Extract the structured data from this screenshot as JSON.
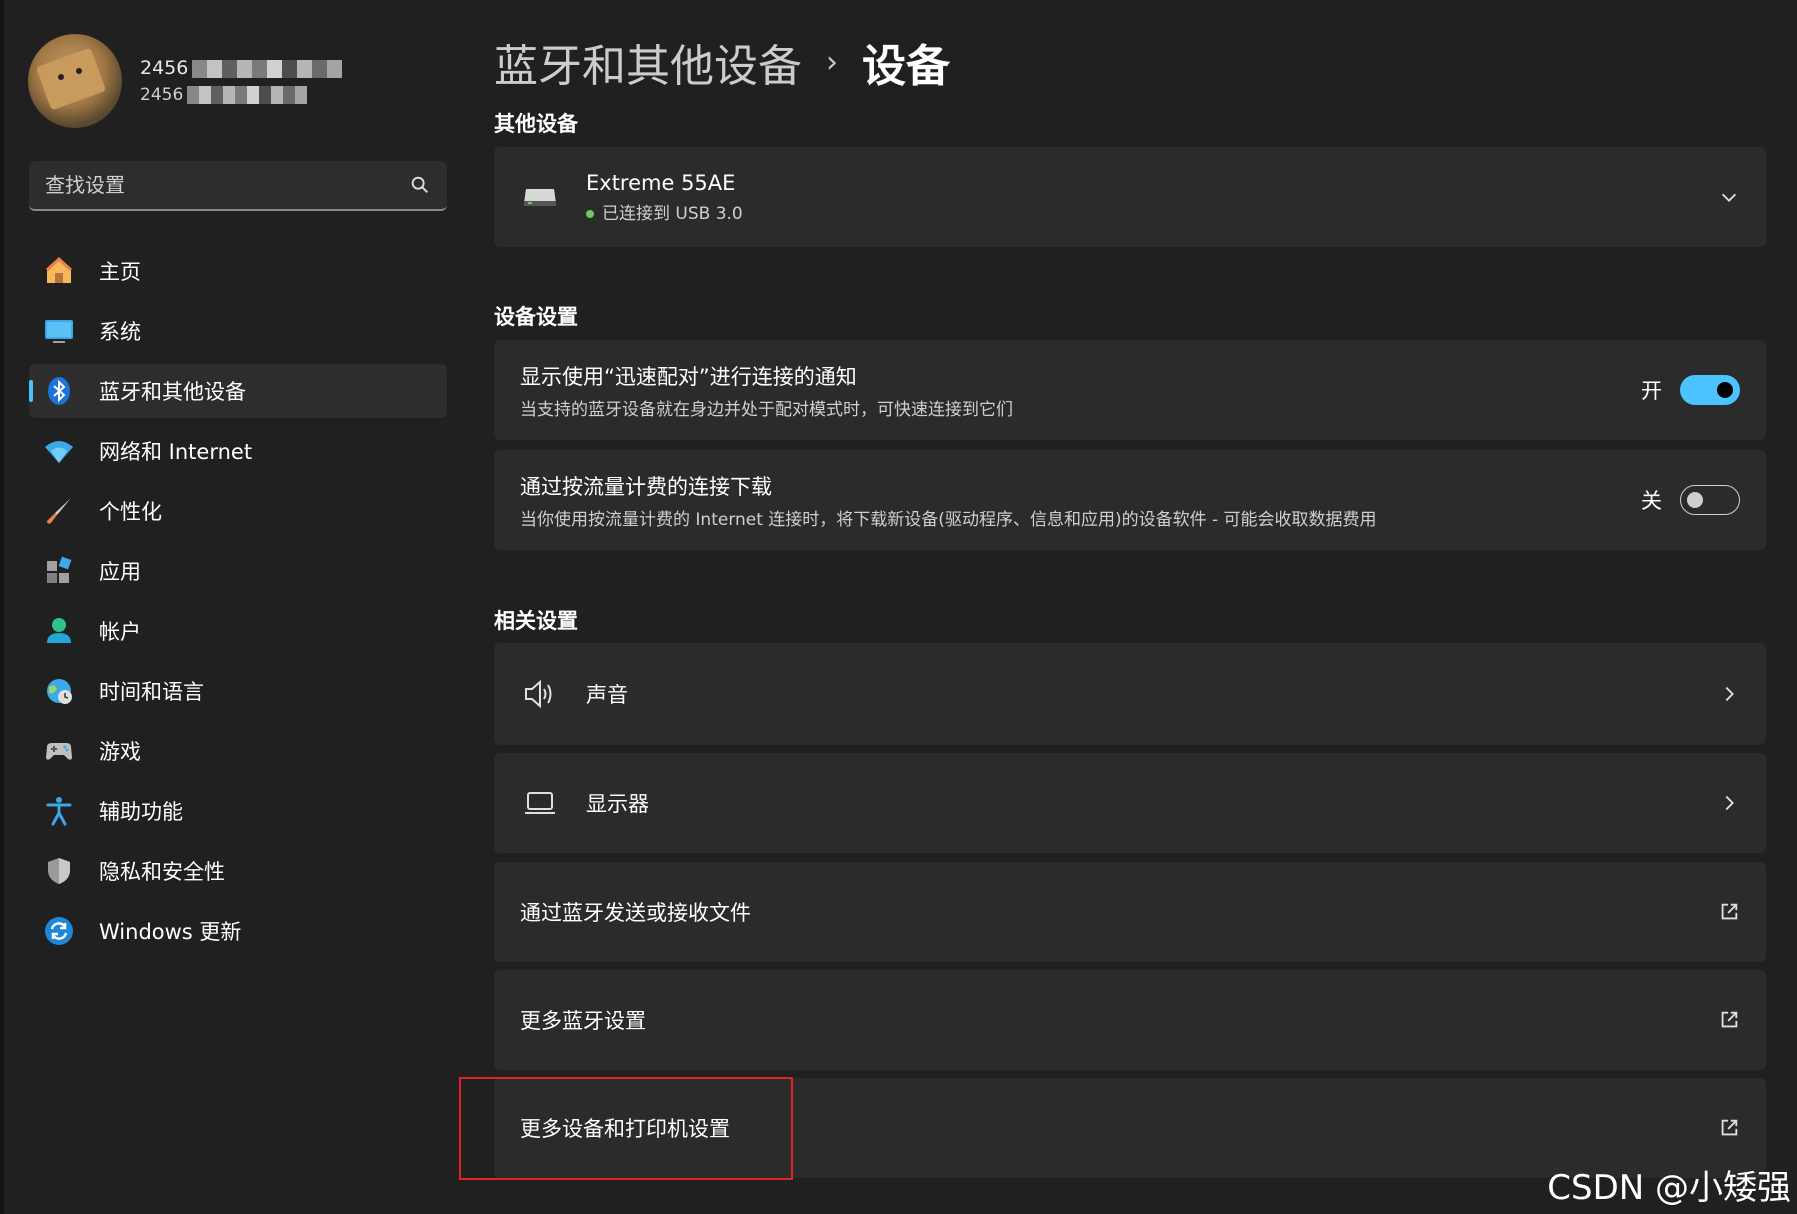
{
  "profile": {
    "name": "2456",
    "email": "2456"
  },
  "search": {
    "placeholder": "查找设置"
  },
  "nav": {
    "items": [
      {
        "label": "主页",
        "icon": "home-icon"
      },
      {
        "label": "系统",
        "icon": "system-icon"
      },
      {
        "label": "蓝牙和其他设备",
        "icon": "bluetooth-icon",
        "active": true
      },
      {
        "label": "网络和 Internet",
        "icon": "wifi-icon"
      },
      {
        "label": "个性化",
        "icon": "brush-icon"
      },
      {
        "label": "应用",
        "icon": "apps-icon"
      },
      {
        "label": "帐户",
        "icon": "account-icon"
      },
      {
        "label": "时间和语言",
        "icon": "globe-clock-icon"
      },
      {
        "label": "游戏",
        "icon": "gamepad-icon"
      },
      {
        "label": "辅助功能",
        "icon": "accessibility-icon"
      },
      {
        "label": "隐私和安全性",
        "icon": "shield-icon"
      },
      {
        "label": "Windows 更新",
        "icon": "update-icon"
      }
    ]
  },
  "breadcrumb": {
    "parent": "蓝牙和其他设备",
    "separator": "›",
    "current": "设备"
  },
  "sections": {
    "other_devices": "其他设备",
    "device_settings": "设备设置",
    "related_settings": "相关设置"
  },
  "device": {
    "name": "Extreme 55AE",
    "status": "已连接到 USB 3.0"
  },
  "swift_pair": {
    "title": "显示使用“迅速配对”进行连接的通知",
    "desc": "当支持的蓝牙设备就在身边并处于配对模式时，可快速连接到它们",
    "state_label": "开"
  },
  "metered": {
    "title": "通过按流量计费的连接下载",
    "desc": "当你使用按流量计费的 Internet 连接时，将下载新设备(驱动程序、信息和应用)的设备软件 - 可能会收取数据费用",
    "state_label": "关"
  },
  "related": {
    "sound": "声音",
    "display": "显示器",
    "bt_files": "通过蓝牙发送或接收文件",
    "more_bt": "更多蓝牙设置",
    "more_devices": "更多设备和打印机设置"
  },
  "watermark": "CSDN @小矮强",
  "colors": {
    "accent": "#4cc2ff",
    "background": "#202020",
    "card": "#2b2b2b",
    "highlight": "#e0242a"
  }
}
